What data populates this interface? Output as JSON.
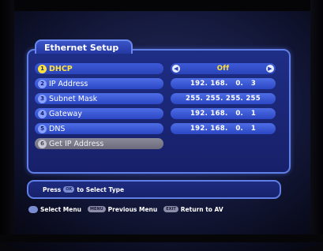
{
  "title": "Ethernet Setup",
  "items": [
    {
      "num": "1",
      "label": "DHCP"
    },
    {
      "num": "2",
      "label": "IP Address"
    },
    {
      "num": "3",
      "label": "Subnet Mask"
    },
    {
      "num": "4",
      "label": "Gateway"
    },
    {
      "num": "5",
      "label": "DNS"
    },
    {
      "num": "6",
      "label": "Get IP Address"
    }
  ],
  "values": {
    "dhcp": "Off",
    "ip": "192. 168.   0.   3",
    "subnet": "255. 255. 255. 255",
    "gateway": "192. 168.   0.   1",
    "dns": "192. 168.   0.   1"
  },
  "help": {
    "press": "Press",
    "ok_key": "OK",
    "text": "to Select Type"
  },
  "footer": {
    "select": "Select Menu",
    "menu_key": "MENU",
    "previous": "Previous Menu",
    "exit_key": "EXIT",
    "return": "Return to AV"
  },
  "colors": {
    "selected_text": "#ffe23a",
    "panel_border": "#5f7fe6",
    "row_blue": "#3a57d6",
    "disabled_row": "#7a7a8c"
  }
}
